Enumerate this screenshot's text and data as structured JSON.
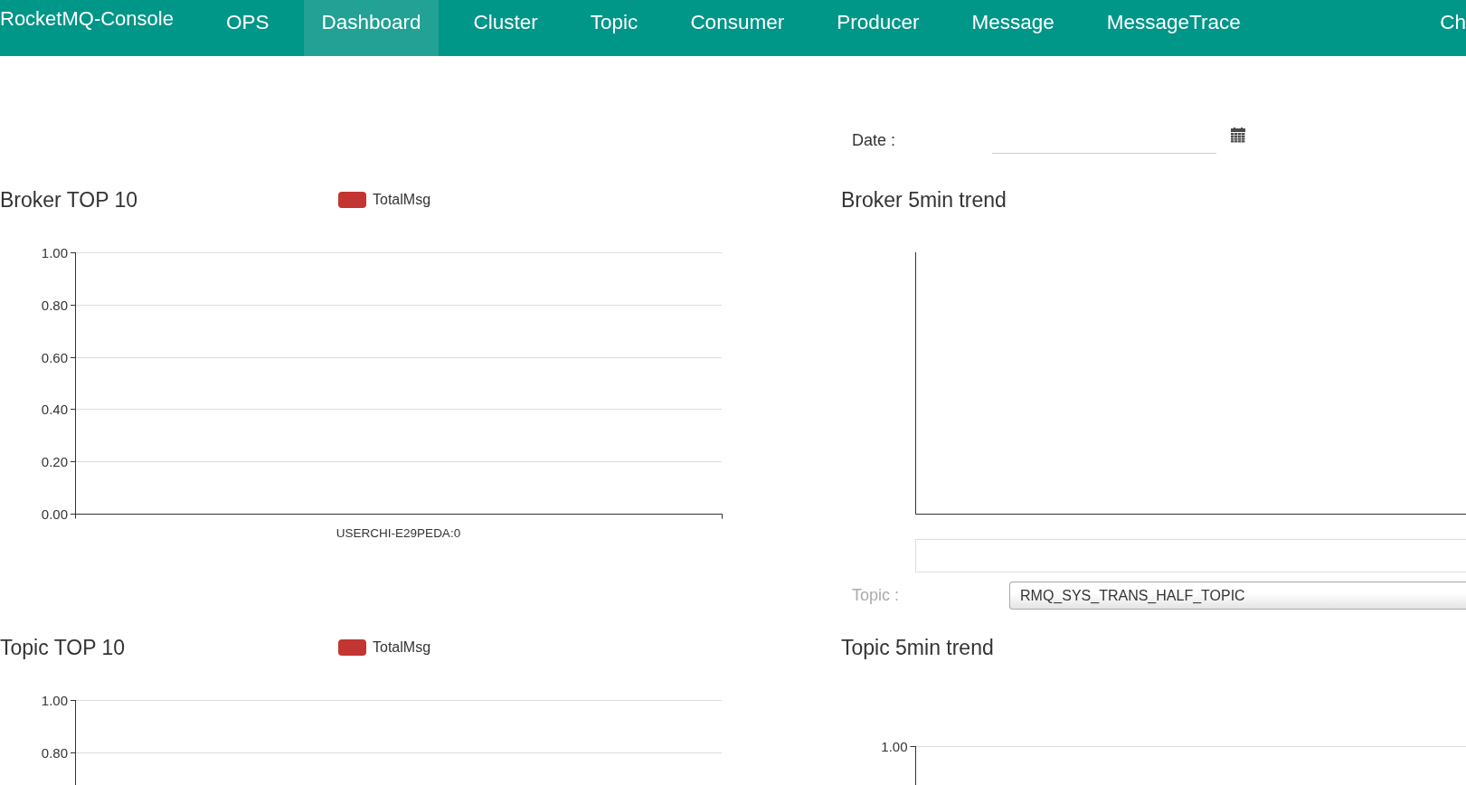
{
  "nav": {
    "brand": "RocketMQ-Console",
    "items": [
      {
        "label": "OPS",
        "selected": false
      },
      {
        "label": "Dashboard",
        "selected": true
      },
      {
        "label": "Cluster",
        "selected": false
      },
      {
        "label": "Topic",
        "selected": false
      },
      {
        "label": "Consumer",
        "selected": false
      },
      {
        "label": "Producer",
        "selected": false
      },
      {
        "label": "Message",
        "selected": false
      },
      {
        "label": "MessageTrace",
        "selected": false
      }
    ],
    "language": "Ch"
  },
  "date_filter": {
    "label": "Date :"
  },
  "broker_top": {
    "chart_data": {
      "type": "bar",
      "title": "Broker TOP 10",
      "categories": [
        "USERCHI-E29PEDA:0"
      ],
      "series": [
        {
          "name": "TotalMsg",
          "color": "#c23531",
          "values": [
            null
          ]
        }
      ],
      "ylim": [
        0,
        1
      ],
      "yticks": [
        {
          "value": 0,
          "label": "0.00"
        },
        {
          "value": 0.2,
          "label": "0.20"
        },
        {
          "value": 0.4,
          "label": "0.40"
        },
        {
          "value": 0.6,
          "label": "0.60"
        },
        {
          "value": 0.8,
          "label": "0.80"
        },
        {
          "value": 1,
          "label": "1.00"
        }
      ],
      "grid": true
    }
  },
  "broker_trend": {
    "title": "Broker 5min trend"
  },
  "topic_filter": {
    "label": "Topic :",
    "value": "RMQ_SYS_TRANS_HALF_TOPIC"
  },
  "topic_top": {
    "chart_data": {
      "type": "bar",
      "title": "Topic TOP 10",
      "series": [
        {
          "name": "TotalMsg",
          "color": "#c23531"
        }
      ],
      "ylim": [
        0,
        1
      ],
      "yticks": [
        {
          "value": 0.8,
          "label": "0.80"
        },
        {
          "value": 1,
          "label": "1.00"
        }
      ],
      "grid": true
    }
  },
  "topic_trend": {
    "title": "Topic 5min trend",
    "axis_labels": [
      "1.00"
    ]
  }
}
